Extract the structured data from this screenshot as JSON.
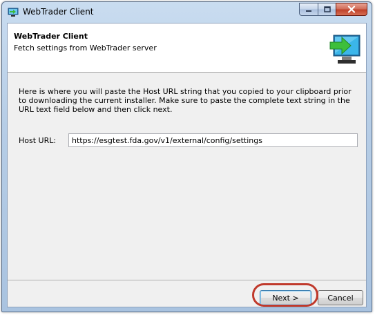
{
  "window": {
    "title": "WebTrader Client"
  },
  "header": {
    "title": "WebTrader Client",
    "subtitle": "Fetch settings from WebTrader server",
    "icon": "monitor-arrow-icon"
  },
  "main": {
    "description": "Here is where you will paste the Host URL string that you copied to your clipboard prior to downloading the current installer. Make sure to paste the complete text string in the URL text field below and then click next.",
    "host_label": "Host URL:",
    "host_value": "https://esgtest.fda.gov/v1/external/config/settings"
  },
  "footer": {
    "next_label": "Next >",
    "cancel_label": "Cancel"
  },
  "colors": {
    "highlight": "#c0392b",
    "arrow": "#4cc84a",
    "screen": "#35b4e8"
  }
}
